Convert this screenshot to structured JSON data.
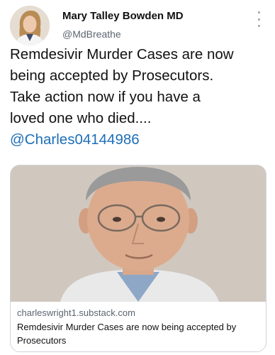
{
  "author": {
    "display_name": "Mary Talley Bowden MD",
    "handle": "@MdBreathe"
  },
  "tweet": {
    "lines": [
      "Remdesivir Murder Cases are now",
      "being accepted by Prosecutors.",
      "Take action now if you have a",
      "loved one who died...."
    ],
    "mention": "@Charles04144986"
  },
  "link_card": {
    "domain": "charleswright1.substack.com",
    "title": "Remdesivir Murder Cases are now being accepted by Prosecutors"
  },
  "icons": {
    "more": "more-vertical-icon"
  },
  "colors": {
    "mention": "#1d6fb8",
    "secondary_text": "#5b6670",
    "card_border": "#cfd6dc"
  }
}
